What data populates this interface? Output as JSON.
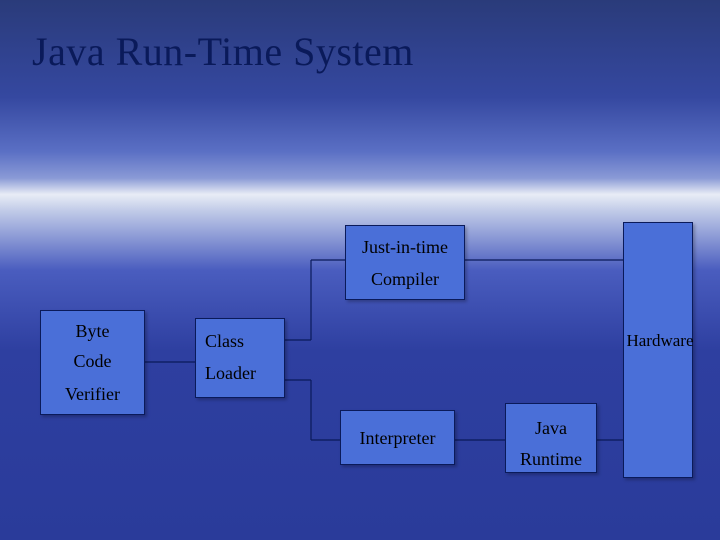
{
  "title": "Java Run-Time System",
  "boxes": {
    "jit": {
      "line1": "Just-in-time",
      "line2": "Compiler"
    },
    "bytecode": {
      "line1": "Byte",
      "line2": "Code",
      "line3": "Verifier"
    },
    "classloader": {
      "line1": "Class",
      "line2": "Loader"
    },
    "interpreter": {
      "line1": "Interpreter"
    },
    "javaruntime": {
      "line1": "Java",
      "line2": "Runtime"
    },
    "hardware": {
      "line1": "Hardware"
    }
  }
}
